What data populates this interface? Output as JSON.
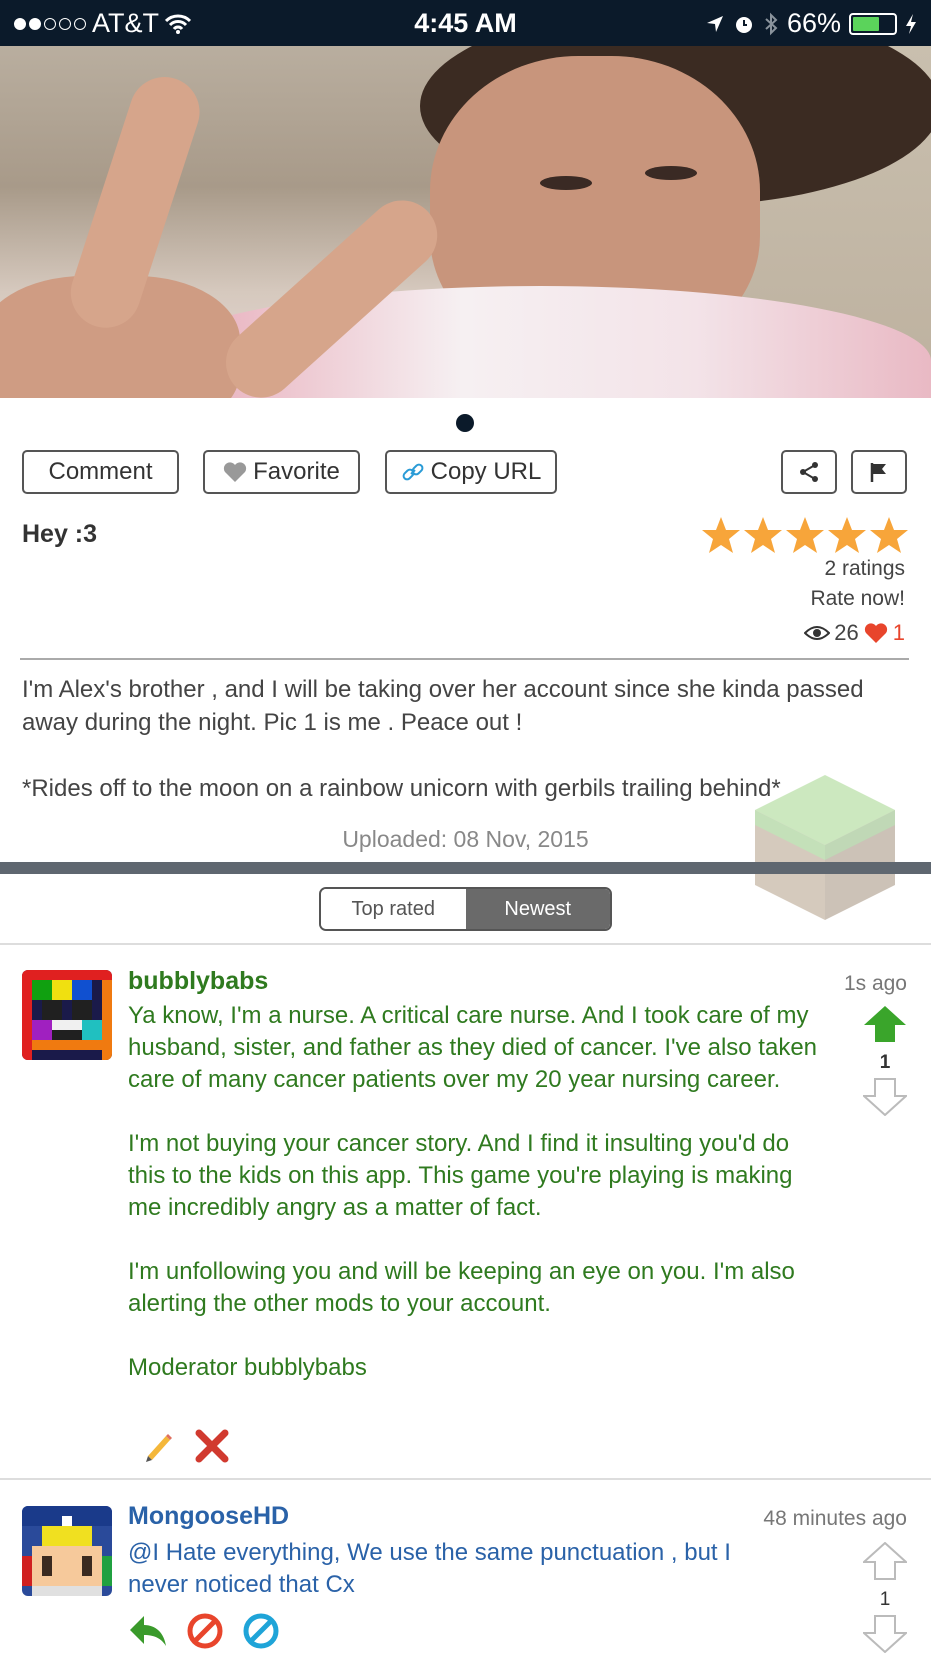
{
  "status_bar": {
    "carrier": "AT&T",
    "time": "4:45 AM",
    "battery_percent": "66%",
    "battery_level": 0.66,
    "signal_bars": 2
  },
  "post": {
    "actions": {
      "comment_label": "Comment",
      "favorite_label": "Favorite",
      "copy_url_label": "Copy URL"
    },
    "title": "Hey :3",
    "rating_stars": 5,
    "ratings_count": "2 ratings",
    "rate_now": "Rate now!",
    "views": "26",
    "favorites": "1",
    "body": [
      "I'm Alex's brother , and I will be taking over her account since she kinda passed away during the night. Pic 1 is me . Peace out !",
      "*Rides off to the moon on a rainbow unicorn with gerbils trailing behind*"
    ],
    "uploaded": "Uploaded: 08 Nov, 2015"
  },
  "sort_tabs": {
    "top_rated": "Top rated",
    "newest": "Newest",
    "selected": "Newest"
  },
  "comments": [
    {
      "user": "bubblybabs",
      "time": "1s ago",
      "votes": "1",
      "paragraphs": [
        "Ya know, I'm a nurse. A critical care nurse. And I took care of my husband, sister, and father as they died of cancer. I've also taken care of many cancer patients over my 20 year nursing career.",
        "I'm not buying your cancer story. And I find it insulting you'd do this to the kids on this app. This game you're playing is making me incredibly angry as a matter of fact.",
        "I'm unfollowing you and will be keeping an eye on you. I'm also alerting the other mods to your account.",
        "Moderator bubblybabs"
      ],
      "actions": [
        "pencil-icon",
        "delete-x-icon"
      ]
    },
    {
      "user": "MongooseHD",
      "time": "48 minutes ago",
      "votes": "1",
      "paragraphs": [
        "@I Hate everything, We use the same punctuation , but I never noticed that Cx"
      ],
      "actions": [
        "reply-arrow-icon",
        "block-red-icon",
        "block-blue-icon"
      ]
    }
  ],
  "colors": {
    "status_bar_bg": "#0b1a2a",
    "moderator_green": "#2f7a1f",
    "user_blue": "#2a62a8",
    "star_orange": "#f7a53a",
    "heart_red": "#e8452c",
    "upvote_green": "#3aa52b"
  }
}
